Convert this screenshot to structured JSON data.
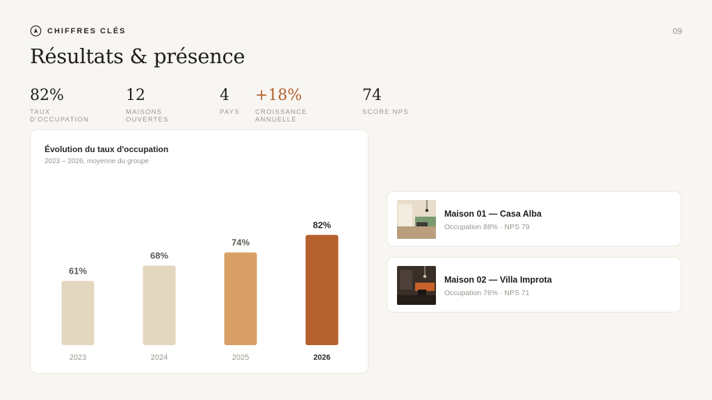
{
  "header": {
    "eyebrow": "CHIFFRES CLÉS",
    "eyebrow_icon": "compass-icon",
    "page_number": "09",
    "title": "Résultats & présence"
  },
  "kpis": [
    {
      "value": "82%",
      "label": "TAUX D'OCCUPATION"
    },
    {
      "value": "12",
      "label": "MAISONS OUVERTES"
    },
    {
      "value": "4",
      "label": "PAYS"
    },
    {
      "value": "+18%",
      "label": "CROISSANCE ANNUELLE",
      "accent": true
    },
    {
      "value": "74",
      "label": "SCORE NPS"
    }
  ],
  "chart_data": {
    "type": "bar",
    "title": "Évolution du taux d'occupation",
    "subtitle": "2023 – 2026, moyenne du groupe",
    "categories": [
      "2023",
      "2024",
      "2025",
      "2026"
    ],
    "values": [
      61,
      68,
      74,
      82
    ],
    "value_labels": [
      "61%",
      "68%",
      "74%",
      "82%"
    ],
    "colors": [
      "#e4d7bf",
      "#e4d7bf",
      "#d8a066",
      "#b5612e"
    ],
    "highlight_category": "2026",
    "grid": false,
    "legend": "none"
  },
  "houses": [
    {
      "name": "Maison 01 — Casa Alba",
      "meta": "Occupation 88% · NPS 79",
      "thumb": "interior-photo-light"
    },
    {
      "name": "Maison 02 — Villa Improta",
      "meta": "Occupation 76% · NPS 71",
      "thumb": "interior-photo-dark"
    }
  ],
  "colors": {
    "background": "#f8f6f2",
    "accent": "#b5612e",
    "muted_text": "#9a958e"
  }
}
